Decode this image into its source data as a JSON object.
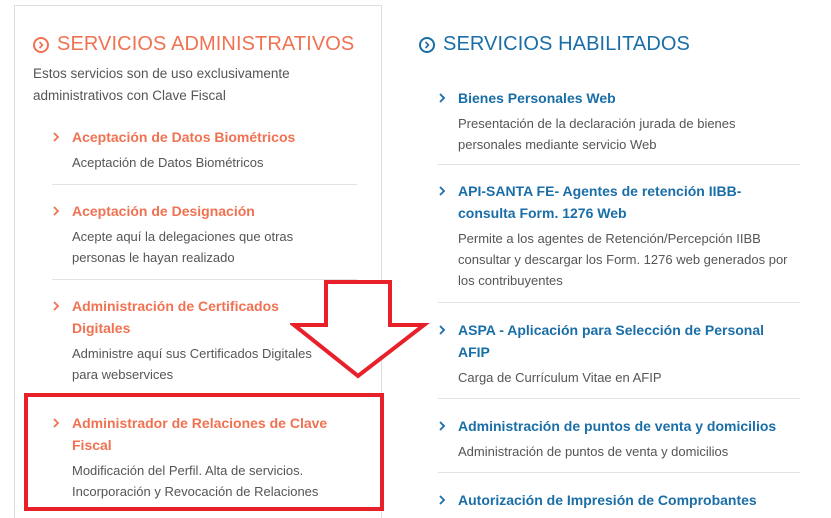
{
  "left": {
    "title": "SERVICIOS ADMINISTRATIVOS",
    "intro": "Estos servicios son de uso exclusivamente administrativos con Clave Fiscal",
    "items": [
      {
        "title": "Aceptación de Datos Biométricos",
        "desc": "Aceptación de Datos Biométricos"
      },
      {
        "title": "Aceptación de Designación",
        "desc": "Acepte aquí la delegaciones que otras personas le hayan realizado"
      },
      {
        "title": "Administración de Certificados Digitales",
        "desc": "Administre aquí sus Certificados Digitales para webservices"
      },
      {
        "title": "Administrador de Relaciones de Clave Fiscal",
        "desc": "Modificación del Perfil. Alta de servicios. Incorporación y Revocación de Relaciones"
      }
    ]
  },
  "right": {
    "title": "SERVICIOS HABILITADOS",
    "items": [
      {
        "title": "Bienes Personales Web",
        "desc": "Presentación de la declaración jurada de bienes personales mediante servicio Web"
      },
      {
        "title": "API-SANTA FE- Agentes de retención IIBB- consulta Form. 1276 Web",
        "desc": "Permite a los agentes de Retención/Percepción IIBB consultar y descargar los Form. 1276 web generados por los contribuyentes"
      },
      {
        "title": "ASPA - Aplicación para Selección de Personal AFIP",
        "desc": "Carga de Currículum Vitae en AFIP"
      },
      {
        "title": "Administración de puntos de venta y domicilios",
        "desc": "Administración de puntos de venta y domicilios"
      },
      {
        "title": "Autorización de Impresión de Comprobantes",
        "desc": ""
      }
    ]
  },
  "colors": {
    "orange": "#f07252",
    "blue": "#1a6ea8",
    "highlight": "#e8202a"
  },
  "icons": {
    "section": "circle-chevron-right-icon",
    "item": "chevron-right-icon",
    "annotation": "down-arrow-outline"
  }
}
